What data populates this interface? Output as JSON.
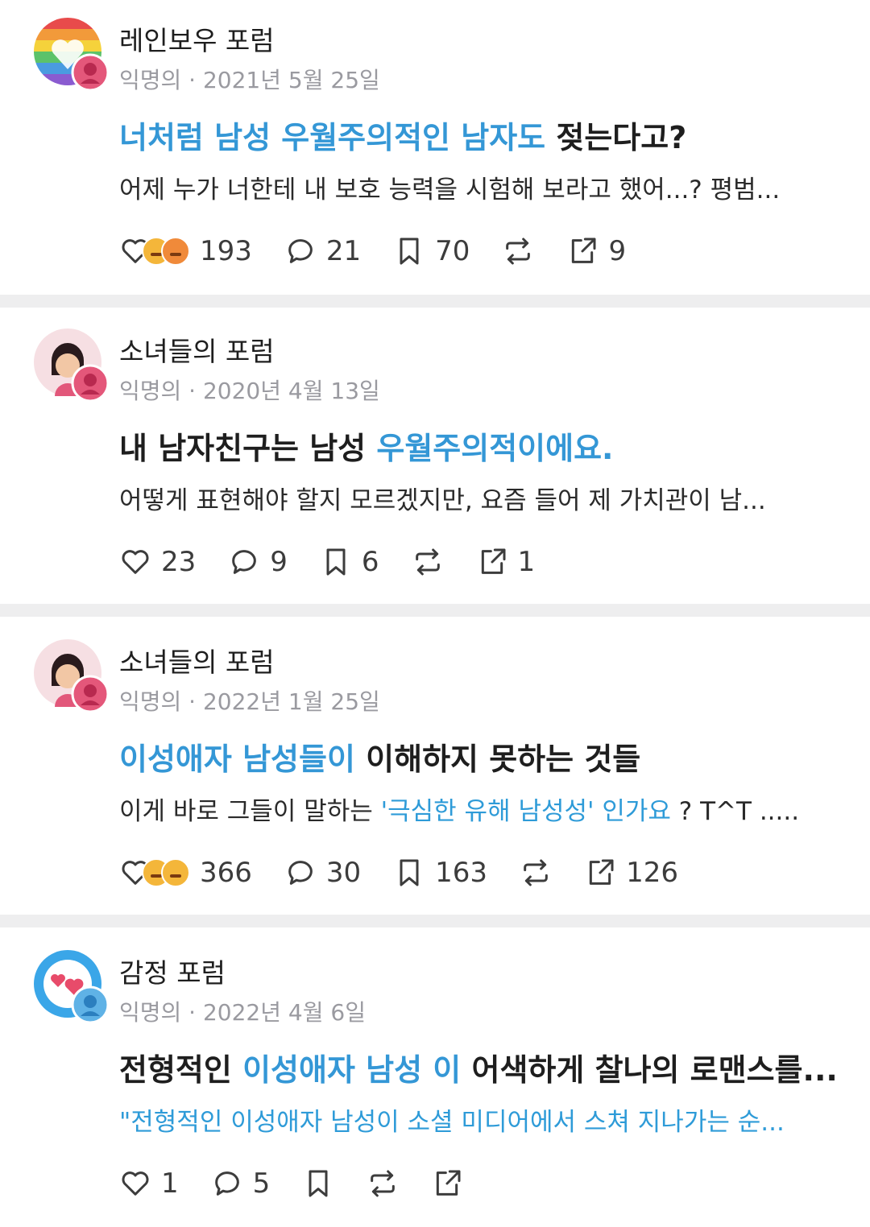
{
  "posts": [
    {
      "forum": "레인보우 포럼",
      "author": "익명의",
      "date": "2021년 5월 25일",
      "title_hl": "너처럼 남성 우월주의적인 남자도",
      "title_rest": " 젖는다고?",
      "excerpt": "어제 누가 너한테 내 보호 능력을 시험해 보라고 했어...? 평범...",
      "likes": "193",
      "comments": "21",
      "saves": "70",
      "shares": "9"
    },
    {
      "forum": "소녀들의 포럼",
      "author": "익명의",
      "date": "2020년 4월 13일",
      "title_plain": "내 남자친구는 남성 ",
      "title_hl": "우월주의적이에요.",
      "excerpt": "어떻게 표현해야 할지 모르겠지만, 요즘 들어 제 가치관이 남...",
      "likes": "23",
      "comments": "9",
      "saves": "6",
      "shares": "1"
    },
    {
      "forum": "소녀들의 포럼",
      "author": "익명의",
      "date": "2022년 1월 25일",
      "title_hl": "이성애자 남성들이",
      "title_rest": " 이해하지 못하는 것들",
      "excerpt_plain": "이게 바로 그들이 말하는 ",
      "excerpt_hl": "'극심한 유해 남성성' 인가요",
      "excerpt_rest": " ? T^T .....",
      "likes": "366",
      "comments": "30",
      "saves": "163",
      "shares": "126"
    },
    {
      "forum": "감정 포럼",
      "author": "익명의",
      "date": "2022년 4월 6일",
      "title_plain": "전형적인 ",
      "title_hl": "이성애자 남성 이",
      "title_rest": " 어색하게 찰나의 로맨스를...",
      "excerpt": "\"전형적인 이성애자 남성이 소셜 미디어에서 스쳐 지나가는 순...",
      "likes": "1",
      "comments": "5"
    }
  ],
  "colors": {
    "accent": "#3497d6",
    "meta": "#9a9aa0",
    "separator": "#eeeeef"
  }
}
